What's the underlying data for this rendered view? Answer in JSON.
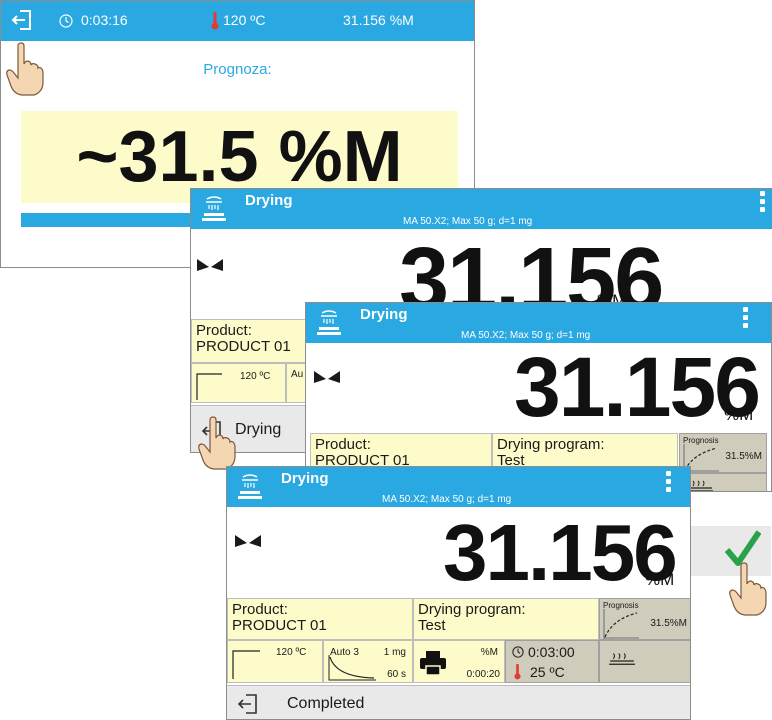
{
  "prognosis_screen": {
    "elapsed_time": "0:03:16",
    "temperature": "120 ºC",
    "moisture": "31.156 %M",
    "title": "Prognoza:",
    "value": "~31.5 %M",
    "progress_fraction": 0.95
  },
  "window": {
    "title": "Drying",
    "subtitle": "MA 50.X2; Max 50 g; d=1 mg",
    "reading": "31.156",
    "unit": "%M"
  },
  "window1": {
    "product_label": "Product:",
    "product_value": "PRODUCT 01",
    "temp": "120 ºC",
    "auto": "Au",
    "bottom_label": "Drying"
  },
  "window2": {
    "product_label": "Product:",
    "product_value": "PRODUCT 01",
    "program_label": "Drying program:",
    "program_value": "Test",
    "prognosis_label": "Prognosis",
    "prognosis_value": "31.5%M"
  },
  "window3": {
    "product_label": "Product:",
    "product_value": "PRODUCT 01",
    "program_label": "Drying program:",
    "program_value": "Test",
    "prognosis_label": "Prognosis",
    "prognosis_value": "31.5%M",
    "temp": "120 ºC",
    "auto_mode": "Auto 3",
    "auto_mass": "1 mg",
    "auto_time": "60 s",
    "print_unit": "%M",
    "print_interval": "0:00:20",
    "status_time": "0:03:00",
    "status_temp": "25 ºC",
    "bottom_label": "Completed"
  },
  "colors": {
    "accent": "#29a8e1",
    "yellow": "#fdfbc9",
    "confirm": "#2aa14a",
    "thermo": "#e53935"
  }
}
